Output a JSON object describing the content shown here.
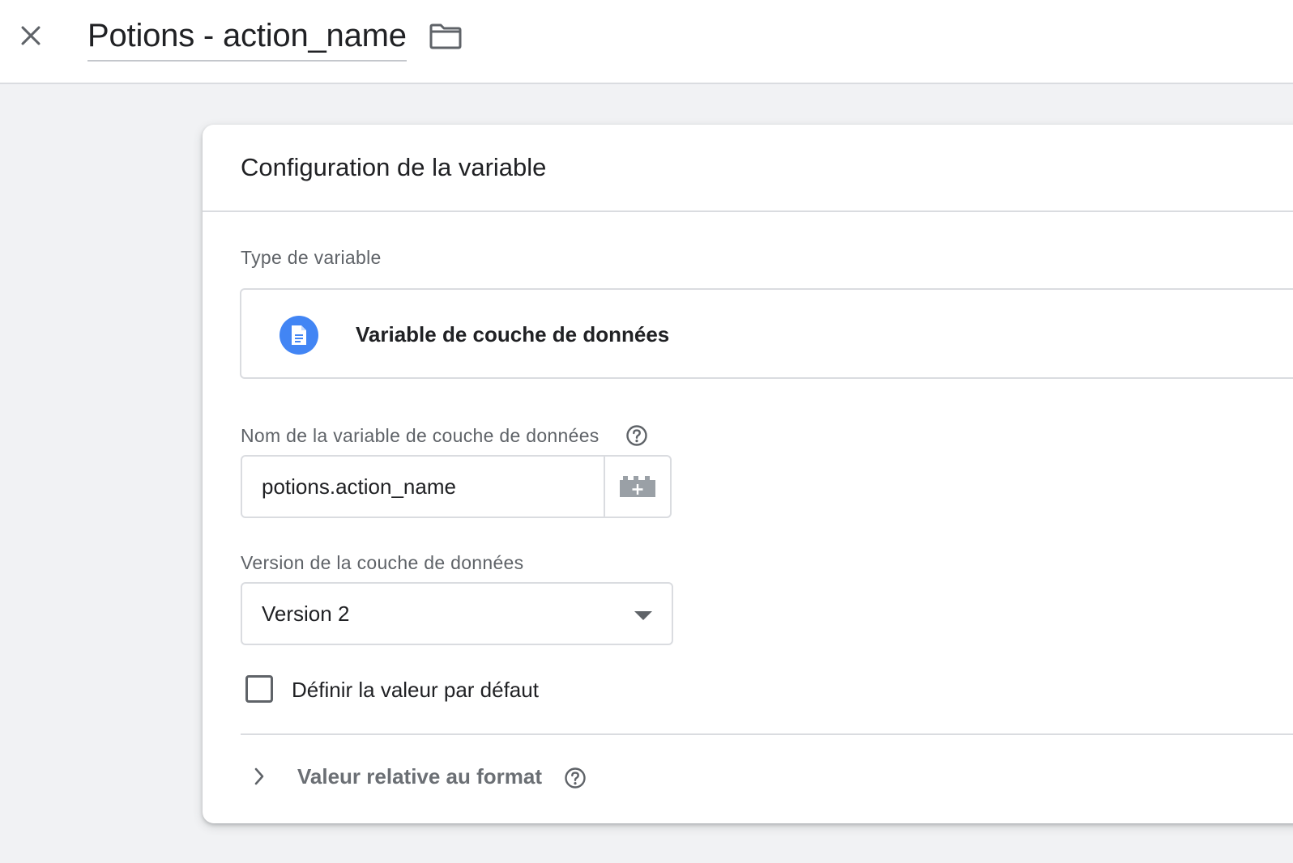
{
  "header": {
    "title": "Potions - action_name",
    "close_icon": "close-icon",
    "folder_icon": "folder-icon"
  },
  "card": {
    "title": "Configuration de la variable",
    "variable_type": {
      "label": "Type de variable",
      "icon": "document-icon",
      "icon_color": "#4285f4",
      "name": "Variable de couche de données"
    },
    "datalayer_name": {
      "label": "Nom de la variable de couche de données",
      "value": "potions.action_name",
      "picker_icon": "add-variable-icon"
    },
    "datalayer_version": {
      "label": "Version de la couche de données",
      "selected": "Version 2"
    },
    "default_value": {
      "label": "Définir la valeur par défaut",
      "checked": false
    },
    "format_value": {
      "label": "Valeur relative au format",
      "expanded": false
    }
  }
}
